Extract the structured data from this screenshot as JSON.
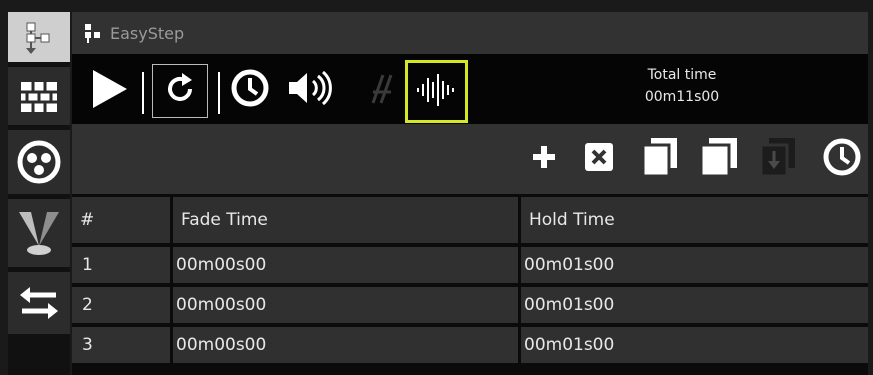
{
  "window": {
    "title": "EasyStep"
  },
  "toolbar": {
    "total_time_label": "Total time",
    "total_time_value": "00m11s00",
    "highlight_color": "#d4e823",
    "buttons": [
      "play-icon",
      "loop-icon",
      "clock-icon",
      "speaker-icon",
      "bpm-icon",
      "audio-waveform-icon"
    ]
  },
  "sidebar": {
    "items": [
      "step-sequence-icon",
      "wall-grid-icon",
      "color-wheel-icon",
      "spotlight-icon",
      "swap-arrows-icon"
    ]
  },
  "actions": {
    "buttons": [
      "add-icon",
      "delete-icon",
      "copy-icon",
      "paste-icon",
      "insert-icon",
      "clock-icon"
    ]
  },
  "table": {
    "columns": [
      "#",
      "Fade Time",
      "Hold Time"
    ],
    "rows": [
      [
        "1",
        "00m00s00",
        "00m01s00"
      ],
      [
        "2",
        "00m00s00",
        "00m01s00"
      ],
      [
        "3",
        "00m00s00",
        "00m01s00"
      ]
    ]
  }
}
